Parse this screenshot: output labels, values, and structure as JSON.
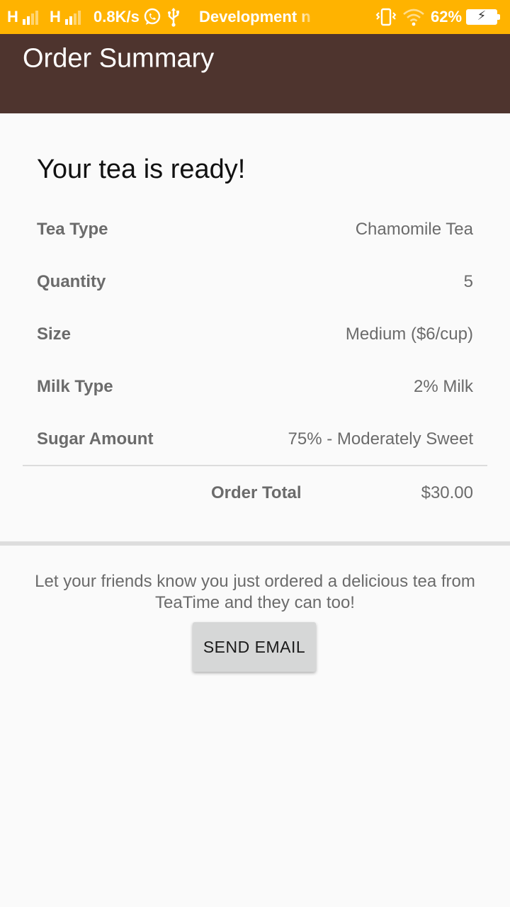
{
  "status_bar": {
    "signal1": "H",
    "signal2": "H",
    "speed": "0.8K/s",
    "notification": "Development n",
    "battery": "62%",
    "icons": [
      "whatsapp-icon",
      "usb-icon",
      "vibrate-icon",
      "wifi-icon",
      "battery-charging-icon"
    ],
    "color": "#ffb300"
  },
  "app_bar": {
    "title": "Order Summary",
    "color": "#4e342e"
  },
  "summary": {
    "headline": "Your tea is ready!",
    "rows": [
      {
        "label": "Tea Type",
        "value": "Chamomile Tea"
      },
      {
        "label": "Quantity",
        "value": "5"
      },
      {
        "label": "Size",
        "value": "Medium ($6/cup)"
      },
      {
        "label": "Milk Type",
        "value": "2% Milk"
      },
      {
        "label": "Sugar Amount",
        "value": "75% - Moderately Sweet"
      }
    ],
    "total_label": "Order Total",
    "total_value": "$30.00"
  },
  "share": {
    "message": "Let your friends know you just ordered a delicious tea from TeaTime and they can too!",
    "button_label": "SEND EMAIL"
  }
}
